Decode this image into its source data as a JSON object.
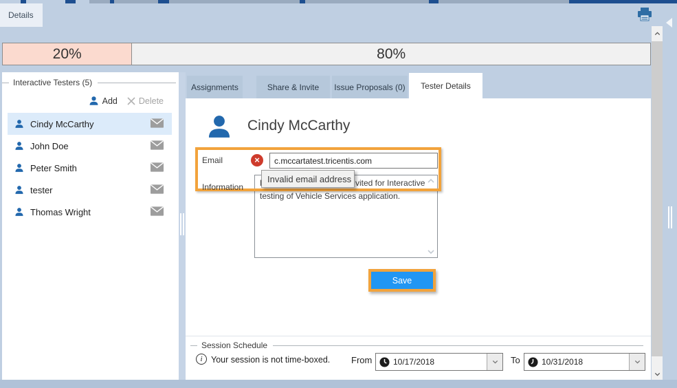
{
  "window": {
    "details_tab": "Details"
  },
  "colors": {
    "accent_orange": "#F2A33C",
    "save_blue": "#2196F3",
    "error_red": "#CE3B2C",
    "selection_blue": "#DCEBFA",
    "icon_blue": "#2268AD",
    "tab_inactive": "#B6C8DB",
    "progress_pink": "#FBDACF"
  },
  "icons": {
    "printer": "printer glyph (blue)",
    "user": "filled person silhouette (blue)",
    "mail": "gray envelope",
    "delete": "gray x cross",
    "error": "red circle with white x",
    "clock": "black clock face",
    "info": "circled italic i",
    "chevron_down": "v chevron",
    "chevron_up": "^ chevron",
    "collapse_left": "white left triangle"
  },
  "progress": {
    "segments": [
      {
        "label": "20%",
        "value": 20
      },
      {
        "label": "80%",
        "value": 80
      }
    ]
  },
  "sidebar": {
    "group_title": "Interactive Testers (5)",
    "add_label": "Add",
    "delete_label": "Delete",
    "testers": [
      {
        "name": "Cindy McCarthy",
        "selected": true
      },
      {
        "name": "John Doe",
        "selected": false
      },
      {
        "name": "Peter Smith",
        "selected": false
      },
      {
        "name": "tester",
        "selected": false
      },
      {
        "name": "Thomas Wright",
        "selected": false
      }
    ]
  },
  "main": {
    "tabs": [
      {
        "label": "Assignments",
        "active": false
      },
      {
        "label": "Share & Invite",
        "active": false
      },
      {
        "label": "Issue Proposals (0)",
        "active": false
      },
      {
        "label": "Tester Details",
        "active": true
      }
    ],
    "tester_details": {
      "name": "Cindy McCarthy",
      "email_label": "Email",
      "email_value": "c.mccartatest.tricentis.com",
      "email_error_tooltip": "Invalid email address",
      "information_label": "Information",
      "information_visible_start": "E",
      "information_visible_line1_end": "vited for Interactive",
      "information_visible_line2": "testing of Vehicle Services application.",
      "save_label": "Save"
    },
    "session_schedule": {
      "group_title": "Session Schedule",
      "info_text": "Your session is not time-boxed.",
      "from_label": "From",
      "from_value": "10/17/2018",
      "to_label": "To",
      "to_value": "10/31/2018"
    }
  }
}
